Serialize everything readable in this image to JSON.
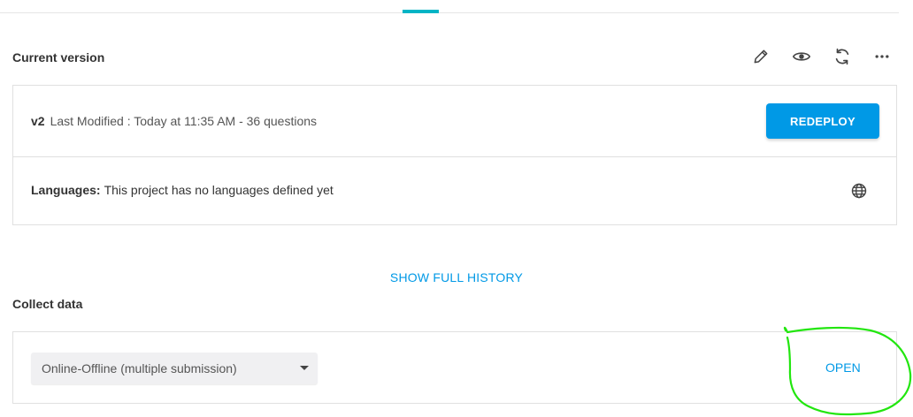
{
  "current_version": {
    "title": "Current version",
    "icons": [
      "pencil-icon",
      "eye-icon",
      "refresh-icon",
      "more-icon"
    ],
    "version_label": "v2",
    "last_modified": "Last Modified : Today at 11:35 AM - 36 questions",
    "redeploy_label": "REDEPLOY",
    "languages_label": "Languages:",
    "languages_value": "This project has no languages defined yet"
  },
  "history": {
    "link_label": "SHOW FULL HISTORY"
  },
  "collect_data": {
    "title": "Collect data",
    "selected_option": "Online-Offline (multiple submission)",
    "open_label": "OPEN"
  },
  "colors": {
    "accent": "#0099e6",
    "tab_indicator": "#00b4c5",
    "annotation": "#22e60f"
  }
}
